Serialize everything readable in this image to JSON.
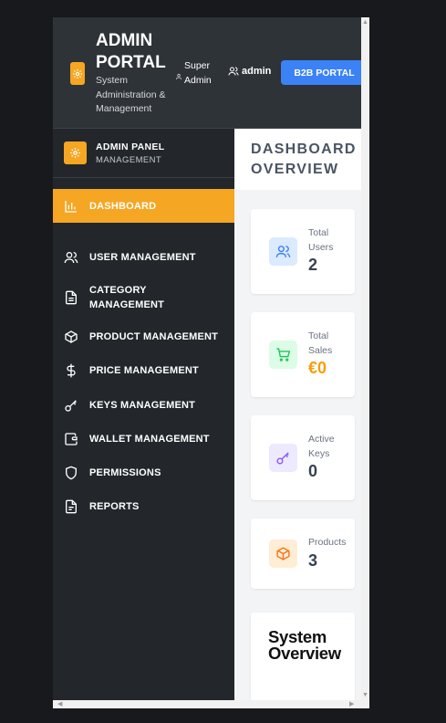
{
  "header": {
    "brand_title": "ADMIN PORTAL",
    "brand_subtitle": "System Administration & Management",
    "role": "Super Admin",
    "username": "admin",
    "b2b_button": "B2B PORTAL"
  },
  "sidebar": {
    "title": "ADMIN PANEL",
    "subtitle": "MANAGEMENT",
    "items": [
      {
        "label": "DASHBOARD",
        "icon": "bar-chart-icon",
        "active": true
      },
      {
        "label": "USER MANAGEMENT",
        "icon": "users-icon"
      },
      {
        "label": "CATEGORY MANAGEMENT",
        "icon": "document-icon"
      },
      {
        "label": "PRODUCT MANAGEMENT",
        "icon": "box-icon"
      },
      {
        "label": "PRICE MANAGEMENT",
        "icon": "dollar-icon"
      },
      {
        "label": "KEYS MANAGEMENT",
        "icon": "key-icon"
      },
      {
        "label": "WALLET MANAGEMENT",
        "icon": "wallet-icon"
      },
      {
        "label": "PERMISSIONS",
        "icon": "shield-icon"
      },
      {
        "label": "REPORTS",
        "icon": "report-icon"
      }
    ]
  },
  "main": {
    "title": "DASHBOARD OVERVIEW",
    "stats": [
      {
        "label": "Total Users",
        "value": "2",
        "icon": "users-icon",
        "color": "#3b82f6"
      },
      {
        "label": "Total Sales",
        "value": "€0",
        "icon": "cart-icon",
        "color": "#22c55e"
      },
      {
        "label": "Active Keys",
        "value": "0",
        "icon": "key-icon",
        "color": "#8b5cf6"
      },
      {
        "label": "Products",
        "value": "3",
        "icon": "box-icon",
        "color": "#f97316"
      }
    ],
    "overview_title": "System Overview"
  },
  "colors": {
    "accent": "#f5a623",
    "header_bg": "#2e3338",
    "sidebar_bg": "#23272b",
    "button_blue": "#3b82f6",
    "sales_value": "#f59e0b"
  }
}
